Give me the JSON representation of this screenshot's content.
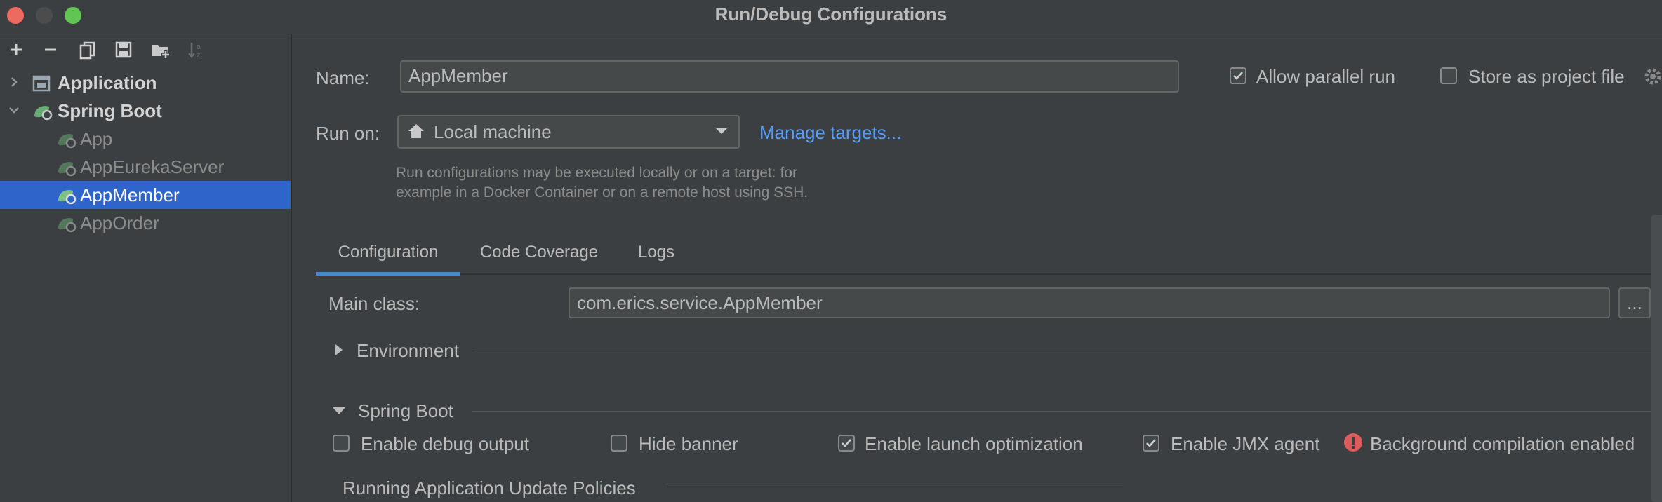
{
  "window": {
    "title": "Run/Debug Configurations",
    "traffic_colors": [
      "#ec6a5e",
      "#4a4c4e",
      "#61c554"
    ]
  },
  "toolbar": {
    "icons": [
      "plus-icon",
      "minus-icon",
      "copy-icon",
      "save-icon",
      "new-folder-icon",
      "sort-icon"
    ]
  },
  "tree": {
    "items": [
      {
        "label": "Application",
        "level": 0,
        "expanded": false
      },
      {
        "label": "Spring Boot",
        "level": 0,
        "expanded": true
      },
      {
        "label": "App",
        "level": 1
      },
      {
        "label": "AppEurekaServer",
        "level": 1
      },
      {
        "label": "AppMember",
        "level": 1,
        "selected": true
      },
      {
        "label": "AppOrder",
        "level": 1
      }
    ]
  },
  "form": {
    "name_label": "Name:",
    "name_value": "AppMember",
    "allow_parallel_label": "Allow parallel run",
    "allow_parallel_checked": true,
    "store_project_label": "Store as project file",
    "store_project_checked": false,
    "run_on_label": "Run on:",
    "run_on_value": "Local machine",
    "manage_targets_link": "Manage targets...",
    "hint_line1": "Run configurations may be executed locally or on a target: for",
    "hint_line2": "example in a Docker Container or on a remote host using SSH."
  },
  "tabs": [
    {
      "label": "Configuration",
      "active": true
    },
    {
      "label": "Code Coverage",
      "active": false
    },
    {
      "label": "Logs",
      "active": false
    }
  ],
  "config": {
    "main_class_label": "Main class:",
    "main_class_value": "com.erics.service.AppMember",
    "browse_label": "...",
    "environment_label": "Environment",
    "spring_boot_label": "Spring Boot",
    "options": [
      {
        "label": "Enable debug output",
        "checked": false
      },
      {
        "label": "Hide banner",
        "checked": false
      },
      {
        "label": "Enable launch optimization",
        "checked": true
      },
      {
        "label": "Enable JMX agent",
        "checked": true
      }
    ],
    "warning_text": "Background compilation enabled",
    "update_policies_label": "Running Application Update Policies"
  },
  "colors": {
    "accent": "#2f65ca",
    "link": "#589df6",
    "tab_underline": "#4a88c7",
    "warning": "#db5c5c",
    "spring_green": "#6aab73"
  }
}
